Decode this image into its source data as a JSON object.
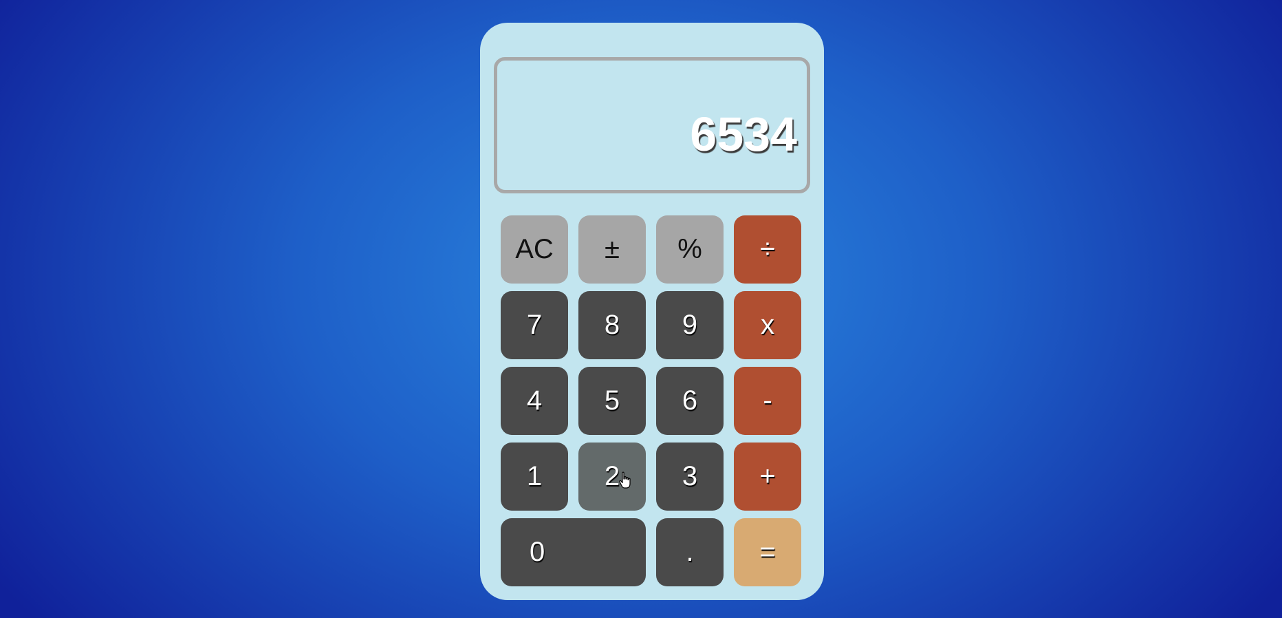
{
  "display": {
    "value": "6534"
  },
  "keys": {
    "row1": [
      "AC",
      "±",
      "%",
      "÷"
    ],
    "row2": [
      "7",
      "8",
      "9",
      "x"
    ],
    "row3": [
      "4",
      "5",
      "6",
      "-"
    ],
    "row4": [
      "1",
      "2",
      "3",
      "+"
    ],
    "row5": [
      "0",
      ".",
      "="
    ]
  },
  "colors": {
    "body": "#c2e5ef",
    "function_key": "#a6a6a6",
    "digit_key": "#4a4a4a",
    "digit_key_hover": "#636a6a",
    "operator_key": "#b04f31",
    "equals_key": "#d8aa72"
  },
  "cursor": {
    "icon": "hand-pointer-icon",
    "over_key": "2"
  }
}
